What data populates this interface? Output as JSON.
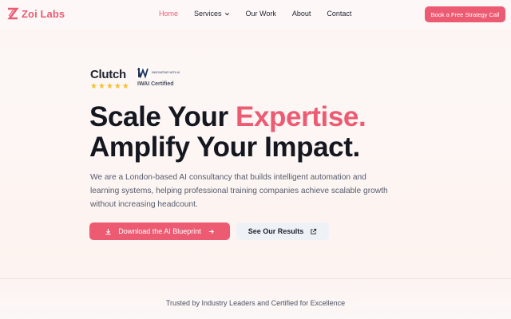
{
  "brand": {
    "name": "Zoi Labs",
    "color": "#ec5b72"
  },
  "nav": {
    "items": [
      {
        "label": "Home",
        "active": true
      },
      {
        "label": "Services",
        "active": false,
        "dropdown": true
      },
      {
        "label": "Our Work",
        "active": false
      },
      {
        "label": "About",
        "active": false
      },
      {
        "label": "Contact",
        "active": false
      }
    ],
    "cta_label": "Book a Free Strategy Call"
  },
  "badges": {
    "clutch": {
      "name": "Clutch",
      "rating_stars": 5
    },
    "iwai": {
      "logo_text": "INNOVATING WITH AI",
      "label": "IWAI Certified"
    }
  },
  "hero": {
    "line1_prefix": "Scale Your ",
    "line1_accent": "Expertise.",
    "line2": "Amplify Your Impact.",
    "description": "We are a London-based AI consultancy that builds intelligent automation and learning systems, helping professional training companies achieve scalable growth without increasing headcount.",
    "primary_button": "Download the AI Blueprint",
    "secondary_button": "See Our Results"
  },
  "trusted_text": "Trusted by Industry Leaders and Certified for Excellence",
  "icons": {
    "download": "download-icon",
    "arrow": "arrow-right-icon",
    "external": "external-link-icon",
    "chevron": "chevron-down-icon"
  }
}
